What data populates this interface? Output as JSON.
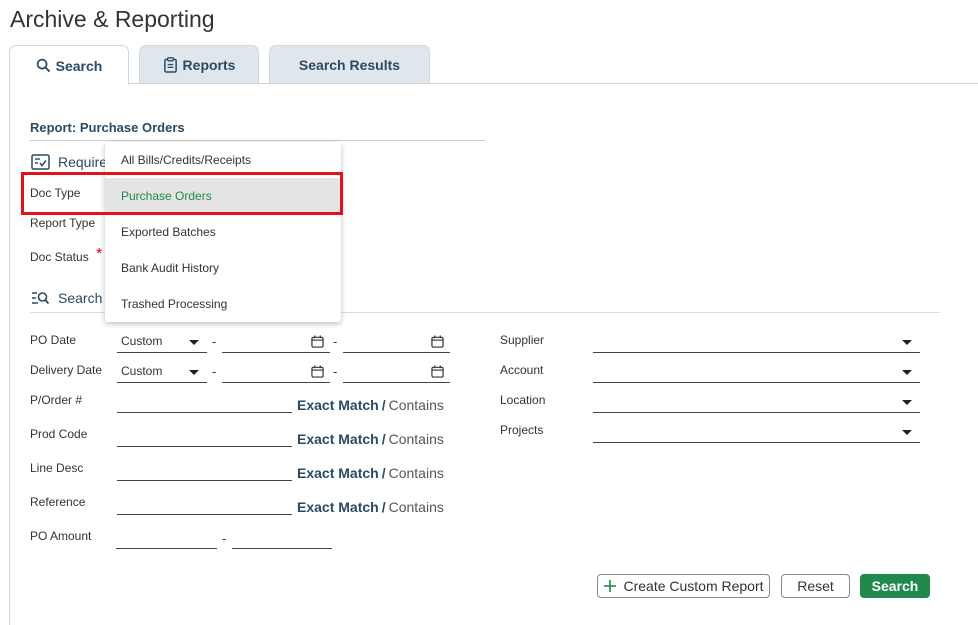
{
  "page_title": "Archive & Reporting",
  "tabs": [
    {
      "label": "Search",
      "icon": "search-icon",
      "active": true
    },
    {
      "label": "Reports",
      "icon": "clipboard-icon",
      "active": false
    },
    {
      "label": "Search Results",
      "icon": "",
      "active": false
    }
  ],
  "report_title": "Report: Purchase Orders",
  "sections": {
    "required_label": "Require",
    "search_label": "Search"
  },
  "required_fields": {
    "doc_type_label": "Doc Type",
    "report_type_label": "Report Type",
    "doc_status_label": "Doc Status",
    "required_marker": "*"
  },
  "dropdown": {
    "options": [
      "All Bills/Credits/Receipts",
      "Purchase Orders",
      "Exported Batches",
      "Bank Audit History",
      "Trashed Processing"
    ],
    "selected": "Purchase Orders"
  },
  "search_fields": {
    "po_date_label": "PO Date",
    "po_date_mode": "Custom",
    "delivery_date_label": "Delivery Date",
    "delivery_date_mode": "Custom",
    "range_separator": "-",
    "porder_label": "P/Order #",
    "prod_code_label": "Prod Code",
    "line_desc_label": "Line Desc",
    "reference_label": "Reference",
    "po_amount_label": "PO Amount",
    "exact_match": "Exact Match",
    "match_separator": "/",
    "contains": "Contains",
    "supplier_label": "Supplier",
    "account_label": "Account",
    "location_label": "Location",
    "projects_label": "Projects"
  },
  "buttons": {
    "create_custom_report": "Create Custom Report",
    "reset": "Reset",
    "search": "Search"
  },
  "colors": {
    "accent_green": "#1f8a4c",
    "heading_blue": "#2b4a63",
    "highlight_red": "#e0121b"
  }
}
